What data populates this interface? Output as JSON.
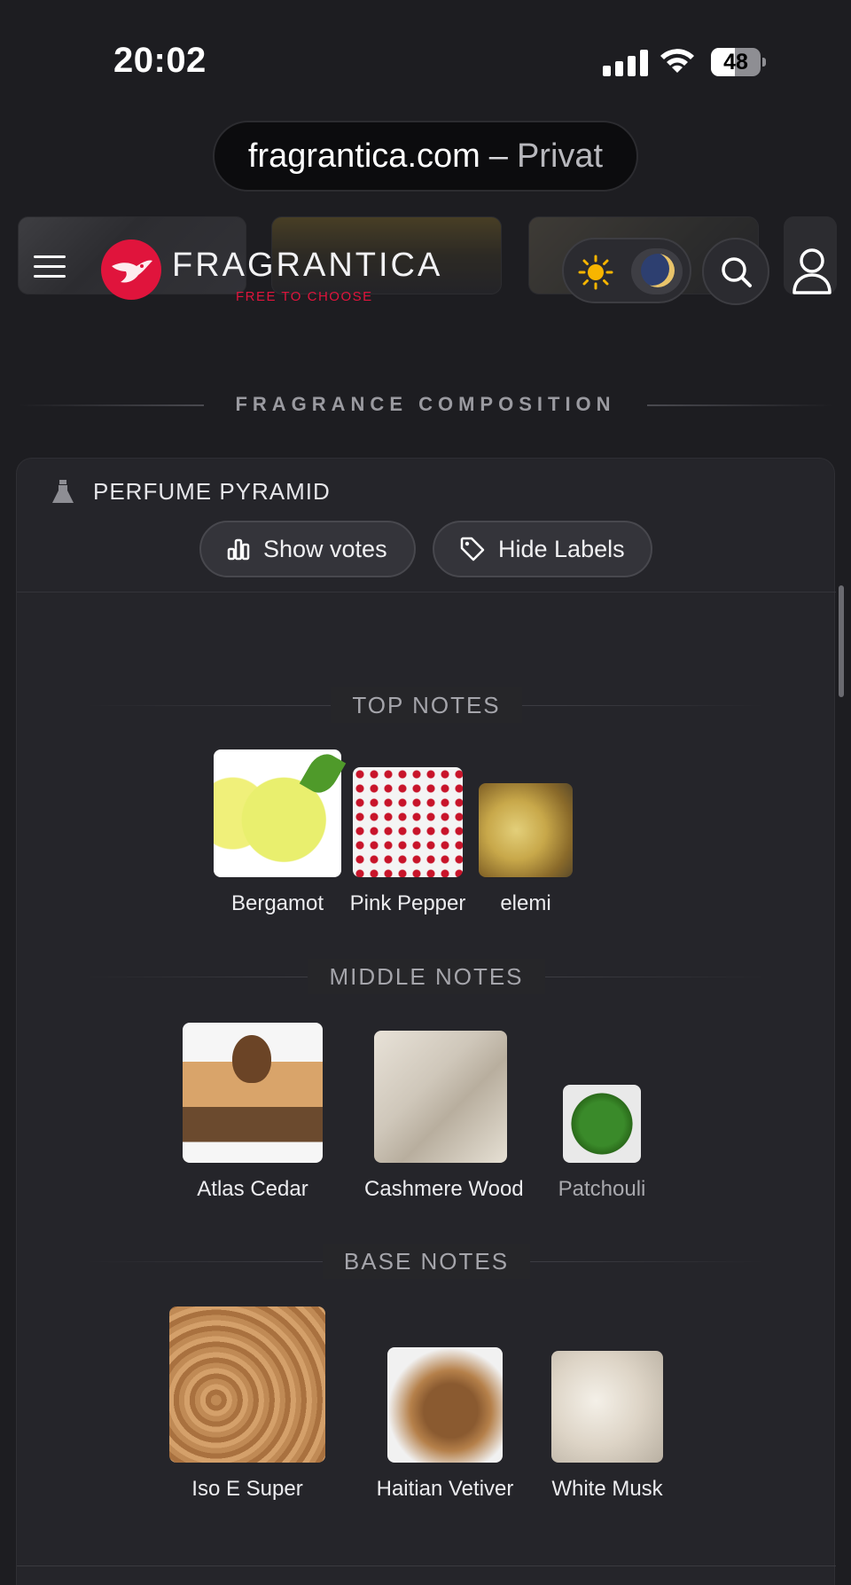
{
  "status_bar": {
    "time": "20:02",
    "battery": "48",
    "battery_level": 0.48
  },
  "browser": {
    "domain": "fragrantica.com",
    "separator": "–",
    "mode": "Privat"
  },
  "header": {
    "brand": "FRAGRANTICA",
    "tagline": "FREE TO CHOOSE"
  },
  "section": {
    "title": "FRAGRANCE COMPOSITION"
  },
  "pyramid": {
    "title": "PERFUME PYRAMID",
    "show_votes": "Show votes",
    "hide_labels": "Hide Labels",
    "tiers": [
      {
        "label": "TOP NOTES",
        "notes": [
          "Bergamot",
          "Pink Pepper",
          "elemi"
        ]
      },
      {
        "label": "MIDDLE NOTES",
        "notes": [
          "Atlas Cedar",
          "Cashmere Wood",
          "Patchouli"
        ]
      },
      {
        "label": "BASE NOTES",
        "notes": [
          "Iso E Super",
          "Haitian Vetiver",
          "White Musk"
        ]
      }
    ]
  },
  "colors": {
    "brand": "#e0143c",
    "background": "#1d1d21",
    "card": "#25252a"
  }
}
